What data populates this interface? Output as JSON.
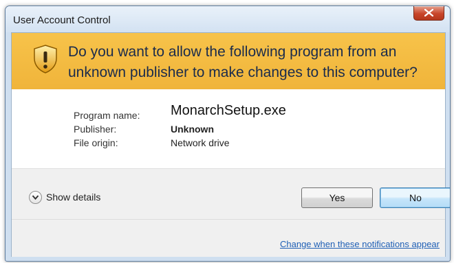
{
  "window": {
    "title": "User Account Control"
  },
  "banner": {
    "question": "Do you want to allow the following program from an unknown publisher to make changes to this computer?"
  },
  "details": [
    {
      "label": "Program name:",
      "value": "MonarchSetup.exe"
    },
    {
      "label": "Publisher:",
      "value": "Unknown"
    },
    {
      "label": "File origin:",
      "value": "Network drive"
    }
  ],
  "footer": {
    "show_details_label": "Show details",
    "yes_label": "Yes",
    "no_label": "No",
    "change_link": "Change when these notifications appear"
  },
  "icons": {
    "banner_icon": "shield-warning-icon",
    "close_icon": "close-icon",
    "toggle_icon": "chevron-down-icon"
  },
  "colors": {
    "banner": "#f2b83f",
    "link": "#1f5fb5",
    "close_button": "#c8452a"
  }
}
